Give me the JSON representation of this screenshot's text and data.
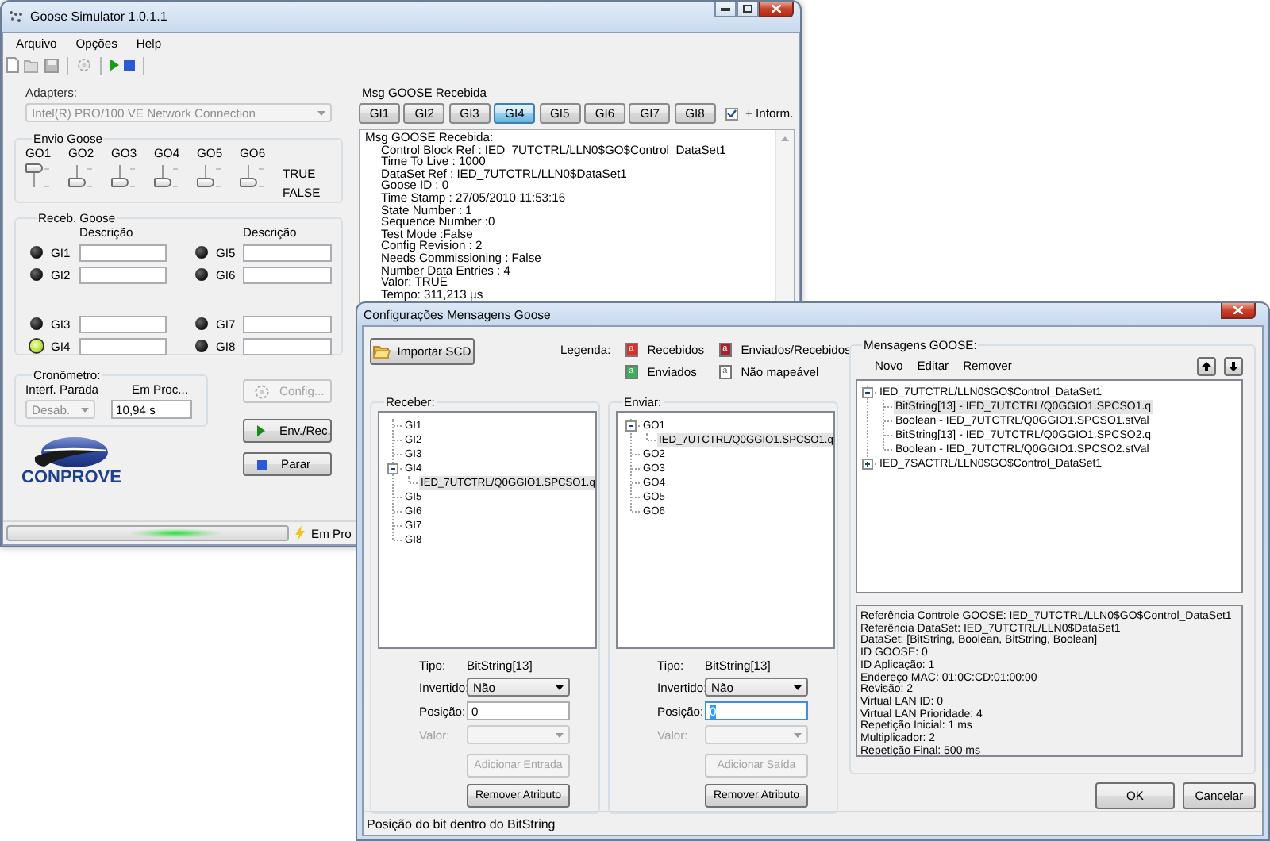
{
  "main_window": {
    "title": "Goose Simulator 1.0.1.1",
    "menu": [
      "Arquivo",
      "Opções",
      "Help"
    ],
    "adapters": {
      "label": "Adapters:",
      "value": "Intel(R) PRO/100 VE Network Connection",
      "disabled": true
    },
    "envio_goose": {
      "title": "Envio Goose",
      "true_label": "TRUE",
      "false_label": "FALSE",
      "switches": [
        {
          "label": "GO1",
          "on": true
        },
        {
          "label": "GO2",
          "on": false
        },
        {
          "label": "GO3",
          "on": false
        },
        {
          "label": "GO4",
          "on": false
        },
        {
          "label": "GO5",
          "on": false
        },
        {
          "label": "GO6",
          "on": false
        }
      ]
    },
    "receb_goose": {
      "title": "Receb. Goose",
      "headers": [
        "Descrição",
        "Descrição"
      ],
      "inputs": [
        {
          "label": "GI1",
          "on": false
        },
        {
          "label": "GI2",
          "on": false
        },
        {
          "label": "GI3",
          "on": false
        },
        {
          "label": "GI4",
          "on": true
        },
        {
          "label": "GI5",
          "on": false
        },
        {
          "label": "GI6",
          "on": false
        },
        {
          "label": "GI7",
          "on": false
        },
        {
          "label": "GI8",
          "on": false
        }
      ]
    },
    "cronometro": {
      "title": "Cronômetro:",
      "stop_label": "Interf. Parada",
      "stop_value": "Desab.",
      "stop_disabled": true,
      "time_label": "Em Proc...",
      "time_value": "10,94 s"
    },
    "buttons": [
      {
        "kind": "config",
        "label": "Config...",
        "disabled": true
      },
      {
        "kind": "play",
        "label": "Env./Rec.",
        "disabled": false
      },
      {
        "kind": "stop",
        "label": "Parar",
        "disabled": false
      }
    ],
    "logo": {
      "text": "CONPROVE"
    },
    "status_bar": {
      "busy": true,
      "text": "Em Pro"
    },
    "message_panel": {
      "title": "Msg GOOSE Recebida",
      "tabs": [
        {
          "label": "GI1",
          "selected": false
        },
        {
          "label": "GI2",
          "selected": false
        },
        {
          "label": "GI3",
          "selected": false
        },
        {
          "label": "GI4",
          "selected": true
        },
        {
          "label": "GI5",
          "selected": false
        },
        {
          "label": "GI6",
          "selected": false
        },
        {
          "label": "GI7",
          "selected": false
        },
        {
          "label": "GI8",
          "selected": false
        }
      ],
      "more_info": {
        "label": "+ Inform.",
        "checked": true
      },
      "heading": "Msg GOOSE Recebida:",
      "lines": [
        "Control Block Ref : IED_7UTCTRL/LLN0$GO$Control_DataSet1",
        "Time To Live : 1000",
        "DataSet Ref : IED_7UTCTRL/LLN0$DataSet1",
        "Goose ID : 0",
        "Time Stamp : 27/05/2010 11:53:16",
        "State Number : 1",
        "Sequence Number :0",
        "Test Mode :False",
        "Config Revision : 2",
        "Needs Commissioning : False",
        "Number Data Entries : 4",
        "Valor: TRUE",
        "Tempo: 311,213 µs"
      ]
    }
  },
  "dialog": {
    "title": "Configurações Mensagens Goose",
    "import_button": "Importar SCD",
    "legend": {
      "label": "Legenda:",
      "items": [
        {
          "label": "Recebidos",
          "swatch": "a",
          "color": "#e52a2a"
        },
        {
          "label": "Enviados",
          "swatch": "a",
          "color": "#3fae5c"
        },
        {
          "label": "Enviados/Recebidos",
          "swatch": "a",
          "color": "#a3262b"
        },
        {
          "label": "Não mapeável",
          "swatch": "a",
          "color": "#ffffff"
        }
      ]
    },
    "panels": [
      {
        "title": "Receber:",
        "tree": [
          {
            "label": "GI1",
            "selected": false
          },
          {
            "label": "GI2",
            "selected": false
          },
          {
            "label": "GI3",
            "selected": false
          },
          {
            "label": "GI4",
            "selected": false,
            "expanded": true,
            "children": [
              {
                "label": "IED_7UTCTRL/Q0GGIO1.SPCSO1.q",
                "selected": true
              }
            ]
          },
          {
            "label": "GI5",
            "selected": false
          },
          {
            "label": "GI6",
            "selected": false
          },
          {
            "label": "GI7",
            "selected": false
          },
          {
            "label": "GI8",
            "selected": false
          }
        ],
        "type_label": "Tipo:",
        "type_value": "BitString[13]",
        "inverted_label": "Invertido:",
        "inverted_value": "Não",
        "position_label": "Posição:",
        "position_value": "0",
        "position_focused": false,
        "value_label": "Valor:",
        "value_disabled": true,
        "add_button": {
          "label": "Adicionar Entrada",
          "disabled": true
        },
        "remove_button": {
          "label": "Remover Atributo",
          "disabled": false
        }
      },
      {
        "title": "Enviar:",
        "tree": [
          {
            "label": "GO1",
            "selected": false,
            "expanded": true,
            "children": [
              {
                "label": "IED_7UTCTRL/Q0GGIO1.SPCSO1.q",
                "selected": true
              }
            ]
          },
          {
            "label": "GO2",
            "selected": false
          },
          {
            "label": "GO3",
            "selected": false
          },
          {
            "label": "GO4",
            "selected": false
          },
          {
            "label": "GO5",
            "selected": false
          },
          {
            "label": "GO6",
            "selected": false
          }
        ],
        "type_label": "Tipo:",
        "type_value": "BitString[13]",
        "inverted_label": "Invertido:",
        "inverted_value": "Não",
        "position_label": "Posição:",
        "position_value": "0",
        "position_focused": true,
        "value_label": "Valor:",
        "value_disabled": true,
        "add_button": {
          "label": "Adicionar Saída",
          "disabled": true
        },
        "remove_button": {
          "label": "Remover Atributo",
          "disabled": false
        }
      }
    ],
    "messages": {
      "title": "Mensagens GOOSE:",
      "actions": [
        "Novo",
        "Editar",
        "Remover"
      ],
      "tree": [
        {
          "label": "IED_7UTCTRL/LLN0$GO$Control_DataSet1",
          "selected": false,
          "expanded": true,
          "children": [
            {
              "label": "BitString[13] - IED_7UTCTRL/Q0GGIO1.SPCSO1.q",
              "selected": true
            },
            {
              "label": "Boolean - IED_7UTCTRL/Q0GGIO1.SPCSO1.stVal",
              "selected": false
            },
            {
              "label": "BitString[13] - IED_7UTCTRL/Q0GGIO1.SPCSO2.q",
              "selected": false
            },
            {
              "label": "Boolean - IED_7UTCTRL/Q0GGIO1.SPCSO2.stVal",
              "selected": false
            }
          ]
        },
        {
          "label": "IED_7SACTRL/LLN0$GO$Control_DataSet1",
          "selected": false,
          "expanded": false
        }
      ],
      "details": [
        "Referência Controle GOOSE: IED_7UTCTRL/LLN0$GO$Control_DataSet1",
        "Referência DataSet: IED_7UTCTRL/LLN0$DataSet1",
        "DataSet: [BitString, Boolean, BitString, Boolean]",
        "ID GOOSE: 0",
        "ID Aplicação: 1",
        "Endereço MAC: 01:0C:CD:01:00:00",
        "Revisão: 2",
        "Virtual LAN ID: 0",
        "Virtual LAN Prioridade: 4",
        "Repetição Inicial: 1 ms",
        "Multiplicador: 2",
        "Repetição Final: 500 ms"
      ]
    },
    "footer_buttons": [
      "OK",
      "Cancelar"
    ],
    "status_bar": "Posição do bit dentro do BitString"
  }
}
